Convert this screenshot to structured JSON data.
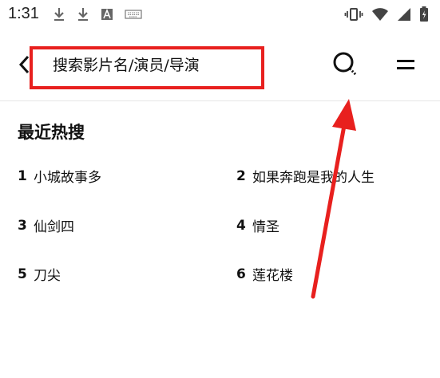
{
  "status_bar": {
    "time": "1:31",
    "left_icons": [
      "download-icon",
      "download-icon",
      "a-box-icon",
      "keyboard-icon"
    ],
    "right_icons": [
      "vibrate-icon",
      "wifi-icon",
      "signal-icon",
      "battery-icon"
    ]
  },
  "toolbar": {
    "search_placeholder": "搜索影片名/演员/导演"
  },
  "hot_search": {
    "title": "最近热搜",
    "items": [
      {
        "rank": "1",
        "title": "小城故事多"
      },
      {
        "rank": "2",
        "title": "如果奔跑是我的人生"
      },
      {
        "rank": "3",
        "title": "仙剑四"
      },
      {
        "rank": "4",
        "title": "情圣"
      },
      {
        "rank": "5",
        "title": "刀尖"
      },
      {
        "rank": "6",
        "title": "莲花楼"
      }
    ]
  },
  "annotation": {
    "color": "#e8201e"
  }
}
